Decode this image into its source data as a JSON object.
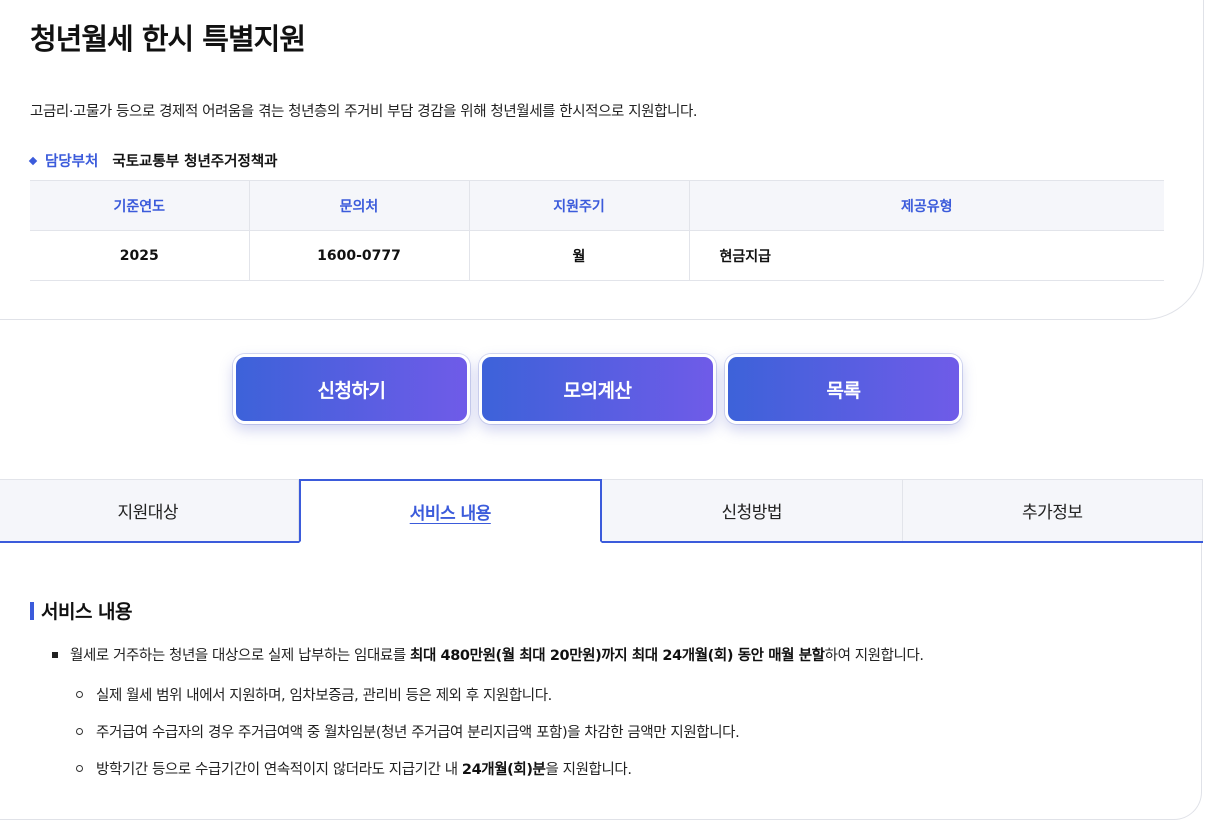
{
  "header": {
    "title": "청년월세 한시 특별지원",
    "description": "고금리·고물가 등으로 경제적 어려움을 겪는 청년층의 주거비 부담 경감을 위해 청년월세를 한시적으로 지원합니다.",
    "dept_label": "담당부처",
    "dept_value": "국토교통부 청년주거정책과"
  },
  "info_table": {
    "headers": [
      "기준연도",
      "문의처",
      "지원주기",
      "제공유형"
    ],
    "row": [
      "2025",
      "1600-0777",
      "월",
      "현금지급"
    ]
  },
  "actions": {
    "apply": "신청하기",
    "simulate": "모의계산",
    "list": "목록"
  },
  "tabs": [
    {
      "label": "지원대상",
      "active": false
    },
    {
      "label": "서비스 내용",
      "active": true
    },
    {
      "label": "신청방법",
      "active": false
    },
    {
      "label": "추가정보",
      "active": false
    }
  ],
  "content": {
    "section_title": "서비스 내용",
    "main": {
      "pre": "월세로 거주하는 청년을 대상으로 실제 납부하는 임대료를 ",
      "bold": "최대 480만원(월 최대 20만원)까지 최대 24개월(회) 동안 매월 분할",
      "post": "하여 지원합니다."
    },
    "sub1": "실제 월세 범위 내에서 지원하며, 임차보증금, 관리비 등은 제외 후 지원합니다.",
    "sub2": "주거급여 수급자의 경우 주거급여액 중 월차임분(청년 주거급여 분리지급액 포함)을 차감한 금액만 지원합니다.",
    "sub3": {
      "pre": "방학기간 등으로 수급기간이 연속적이지 않더라도 지급기간 내 ",
      "bold": "24개월(회)분",
      "post": "을 지원합니다."
    }
  },
  "colors": {
    "accent": "#3b5bdb",
    "gradient_start": "#3d62d9",
    "gradient_end": "#6f5be8"
  }
}
